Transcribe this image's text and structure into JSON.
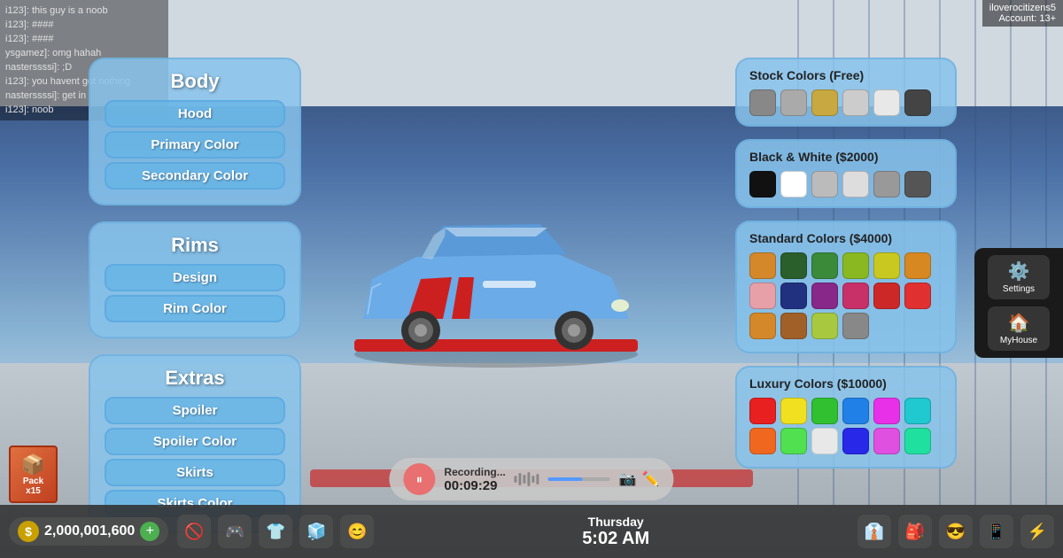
{
  "username": {
    "name": "iloverocitizens5",
    "account": "Account: 13+"
  },
  "chat": {
    "lines": [
      "i123]: this guy is a noob",
      "i123]: ####",
      "i123]: ####",
      "ysgamez]: omg hahah",
      "nasterssssi]: ;D",
      "i123]: you havent got nothing",
      "nasterssssi]: get in",
      "i123]: noob"
    ]
  },
  "body_panel": {
    "title": "Body",
    "buttons": [
      "Hood",
      "Primary Color",
      "Secondary Color"
    ]
  },
  "rims_panel": {
    "title": "Rims",
    "buttons": [
      "Design",
      "Rim Color"
    ]
  },
  "extras_panel": {
    "title": "Extras",
    "buttons": [
      "Spoiler",
      "Spoiler Color",
      "Skirts",
      "Skirts Color"
    ]
  },
  "stock_colors": {
    "title": "Stock Colors (Free)",
    "swatches": [
      "#888888",
      "#aaaaaa",
      "#c8a840",
      "#cccccc",
      "#e8e8e8",
      "#444444"
    ]
  },
  "bw_colors": {
    "title": "Black & White ($2000)",
    "swatches": [
      "#111111",
      "#ffffff",
      "#bbbbbb",
      "#dddddd",
      "#999999",
      "#555555"
    ]
  },
  "standard_colors": {
    "title": "Standard Colors ($4000)",
    "row1": [
      "#d4882a",
      "#2a5e2a",
      "#3a8a3a",
      "#8ab820",
      "#c8c820",
      "#d88820"
    ],
    "row2": [
      "#e8a0a8",
      "#223080",
      "#882888",
      "#c83068",
      "#cc2828",
      "#e03030"
    ],
    "row3": [
      "#d4882a",
      "#a06028",
      "#a8c840",
      "#888888",
      "",
      ""
    ]
  },
  "luxury_colors": {
    "title": "Luxury Colors ($10000)",
    "row1": [
      "#e82020",
      "#f0e020",
      "#30c030",
      "#2080e8",
      "#e830e8",
      "#20c8d0"
    ],
    "row2": [
      "#f06820",
      "#50e050",
      "#e8e8e8",
      "#2828e8",
      "#e050e0",
      "#20e0a0"
    ]
  },
  "money": {
    "amount": "2,000,001,600",
    "symbol": "$"
  },
  "recording": {
    "label": "Recording...",
    "time": "00:09:29"
  },
  "time_display": {
    "day": "Thursday",
    "time": "5:02 AM"
  },
  "bottom_icons": [
    "🚫",
    "🎮",
    "👕",
    "🧊",
    "😊",
    "📱",
    "⚡"
  ],
  "phone_buttons": [
    {
      "icon": "⚙️",
      "label": "Settings"
    },
    {
      "icon": "🏠",
      "label": "MyHouse"
    }
  ],
  "book_pack": {
    "label": "Pack",
    "sub": "x15"
  }
}
